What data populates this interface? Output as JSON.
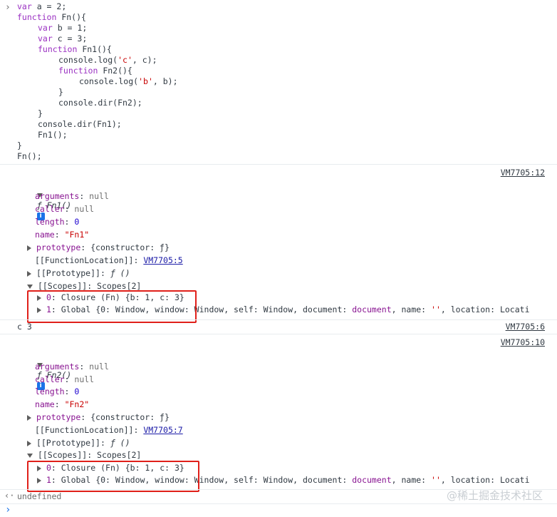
{
  "code_lines": [
    {
      "indent": 0,
      "parts": [
        [
          "kw",
          "var"
        ],
        [
          "t",
          " a = "
        ],
        [
          "t",
          "2"
        ],
        [
          "t",
          ";"
        ]
      ]
    },
    {
      "indent": 0,
      "parts": [
        [
          "kw",
          "function"
        ],
        [
          "t",
          " Fn(){"
        ]
      ]
    },
    {
      "indent": 1,
      "parts": [
        [
          "kw",
          "var"
        ],
        [
          "t",
          " b = 1;"
        ]
      ]
    },
    {
      "indent": 1,
      "parts": [
        [
          "kw",
          "var"
        ],
        [
          "t",
          " c = 3;"
        ]
      ]
    },
    {
      "indent": 1,
      "parts": [
        [
          "kw",
          "function"
        ],
        [
          "t",
          " Fn1(){"
        ]
      ]
    },
    {
      "indent": 2,
      "parts": [
        [
          "t",
          "console.log("
        ],
        [
          "str",
          "'c'"
        ],
        [
          "t",
          ", c);"
        ]
      ]
    },
    {
      "indent": 2,
      "parts": [
        [
          "kw",
          "function"
        ],
        [
          "t",
          " Fn2(){"
        ]
      ]
    },
    {
      "indent": 3,
      "parts": [
        [
          "t",
          "console.log("
        ],
        [
          "str",
          "'b'"
        ],
        [
          "t",
          ", b);"
        ]
      ]
    },
    {
      "indent": 2,
      "parts": [
        [
          "t",
          "}"
        ]
      ]
    },
    {
      "indent": 2,
      "parts": [
        [
          "t",
          "console.dir(Fn2);"
        ]
      ]
    },
    {
      "indent": 1,
      "parts": [
        [
          "t",
          "}"
        ]
      ]
    },
    {
      "indent": 1,
      "parts": [
        [
          "t",
          "console.dir(Fn1);"
        ]
      ]
    },
    {
      "indent": 1,
      "parts": [
        [
          "t",
          "Fn1();"
        ]
      ]
    },
    {
      "indent": 0,
      "parts": [
        [
          "t",
          "}"
        ]
      ]
    },
    {
      "indent": 0,
      "parts": [
        [
          "t",
          "Fn();"
        ]
      ]
    }
  ],
  "fn1": {
    "source": "VM7705:12",
    "header": "ƒ Fn1()",
    "info_icon": "i",
    "arguments_key": "arguments",
    "arguments_val": "null",
    "caller_key": "caller",
    "caller_val": "null",
    "length_key": "length",
    "length_val": "0",
    "name_key": "name",
    "name_val": "\"Fn1\"",
    "prototype_key": "prototype",
    "prototype_val": "{constructor: ƒ}",
    "fnloc_key": "[[FunctionLocation]]: ",
    "fnloc_link": "VM7705:5",
    "proto_key": "[[Prototype]]",
    "proto_val": "ƒ ()",
    "scopes_key": "[[Scopes]]",
    "scopes_val": "Scopes[2]",
    "scope0_key": "0",
    "scope0_val": "Closure (Fn) {b: 1, c: 3}",
    "scope1_key": "1",
    "scope1_val": "Global {0: Window, window: Window, self: Window, document: ",
    "scope1_doc": "document",
    "scope1_mid": ", name: ",
    "scope1_name": "''",
    "scope1_end": ", location: Locati"
  },
  "log_c": {
    "text": "c 3",
    "source": "VM7705:6"
  },
  "fn2": {
    "source": "VM7705:10",
    "header": "ƒ Fn2()",
    "info_icon": "i",
    "arguments_key": "arguments",
    "arguments_val": "null",
    "caller_key": "caller",
    "caller_val": "null",
    "length_key": "length",
    "length_val": "0",
    "name_key": "name",
    "name_val": "\"Fn2\"",
    "prototype_key": "prototype",
    "prototype_val": "{constructor: ƒ}",
    "fnloc_key": "[[FunctionLocation]]: ",
    "fnloc_link": "VM7705:7",
    "proto_key": "[[Prototype]]",
    "proto_val": "ƒ ()",
    "scopes_key": "[[Scopes]]",
    "scopes_val": "Scopes[2]",
    "scope0_key": "0",
    "scope0_val": "Closure (Fn) {b: 1, c: 3}",
    "scope1_key": "1",
    "scope1_val": "Global {0: Window, window: Window, self: Window, document: ",
    "scope1_doc": "document",
    "scope1_mid": ", name: ",
    "scope1_name": "''",
    "scope1_end": ", location: Locati"
  },
  "result": "undefined",
  "watermark": "@稀土掘金技术社区",
  "prompt_glyph": "›",
  "colors": {
    "highlight_box": "#e0201a",
    "keyword": "#9a30c2",
    "property": "#881391",
    "string": "#c80000",
    "number": "#1c00cf",
    "link": "#1a1aa6"
  }
}
